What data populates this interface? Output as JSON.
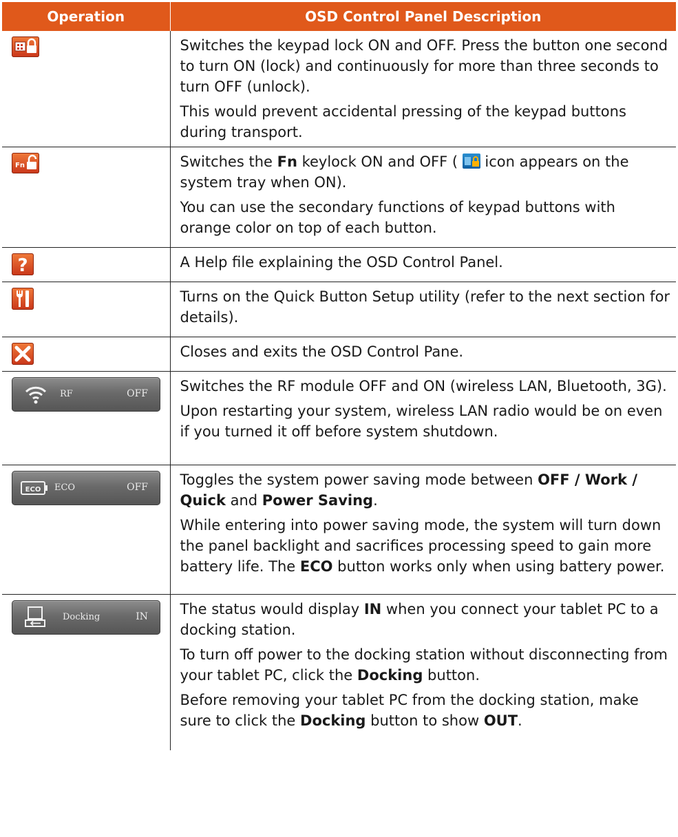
{
  "header": {
    "col_operation": "Operation",
    "col_description": "OSD Control Panel Description"
  },
  "rows": [
    {
      "icon": "keypad-lock-icon",
      "p1": "Switches the keypad lock ON and OFF. Press the button one second to turn ON (lock) and continuously for more than three seconds to turn OFF (unlock).",
      "p2": "This would prevent accidental pressing of the keypad buttons during transport."
    },
    {
      "icon": "fn-lock-icon",
      "p1_a": "Switches the ",
      "p1_b": "Fn",
      "p1_c": " keylock ON and OFF (",
      "p1_d": " icon appears on the system tray when ON).",
      "p2": "You can use the secondary functions of keypad buttons with orange color on top of each button."
    },
    {
      "icon": "help-icon",
      "p1": "A Help file explaining the OSD Control Panel."
    },
    {
      "icon": "tools-icon",
      "p1": "Turns on the Quick Button Setup utility (refer to the next section for details)."
    },
    {
      "icon": "close-icon",
      "p1": "Closes and exits the OSD Control Pane."
    },
    {
      "icon": "wifi-icon",
      "button_label": "RF",
      "button_state": "OFF",
      "p1": "Switches the RF module OFF and ON (wireless LAN, Bluetooth, 3G).",
      "p2": "Upon restarting your system, wireless LAN radio would be on even if you turned it off before system shutdown."
    },
    {
      "icon": "eco-icon",
      "button_icon_text": "ECO",
      "button_label": "ECO",
      "button_state": "OFF",
      "p1_a": "Toggles the system power saving mode between ",
      "p1_b": "OFF / Work / Quick",
      "p1_c": " and ",
      "p1_d": "Power Saving",
      "p1_e": ".",
      "p2_a": "While entering into power saving mode, the system will turn down the panel backlight and sacrifices processing speed to gain more battery life. The ",
      "p2_b": "ECO",
      "p2_c": " button works only when using battery power."
    },
    {
      "icon": "docking-icon",
      "button_label": "Docking",
      "button_state": "IN",
      "p1_a": "The status would display ",
      "p1_b": "IN",
      "p1_c": " when you connect your tablet PC to a docking station.",
      "p2_a": "To turn off power to the docking station without disconnecting from your tablet PC, click the ",
      "p2_b": "Docking",
      "p2_c": " button.",
      "p3_a": "Before removing your tablet PC from the docking station, make sure to click the ",
      "p3_b": "Docking",
      "p3_c": " button to show ",
      "p3_d": "OUT",
      "p3_e": "."
    }
  ]
}
